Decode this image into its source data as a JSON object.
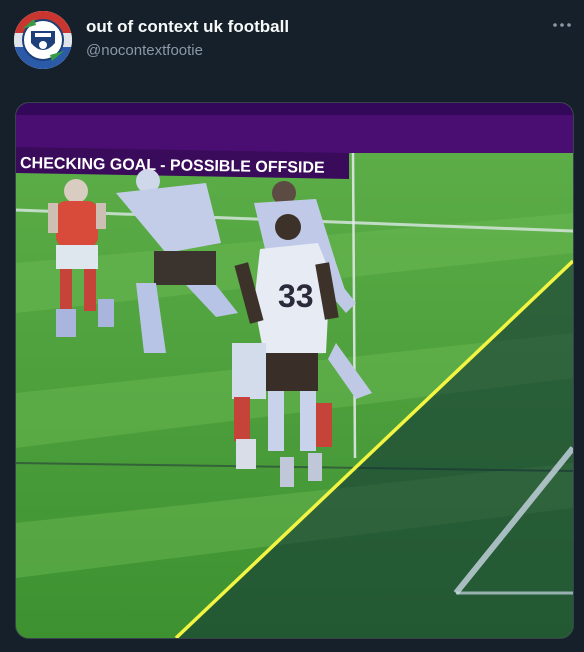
{
  "tweet": {
    "author": {
      "display_name": "out of context uk football",
      "handle": "@nocontextfootie",
      "avatar_icon": "club-crest-icon"
    },
    "more_icon": "more-dots-icon",
    "media": {
      "banner_text": "CHECKING GOAL - POSSIBLE OFFSIDE",
      "player_number": "33",
      "colors": {
        "background": "#15202b",
        "banner": "#3a0b5a",
        "pitch": "#3f9a2e",
        "offside_line": "#f2f542",
        "overlay": "#0d2a35"
      }
    }
  }
}
